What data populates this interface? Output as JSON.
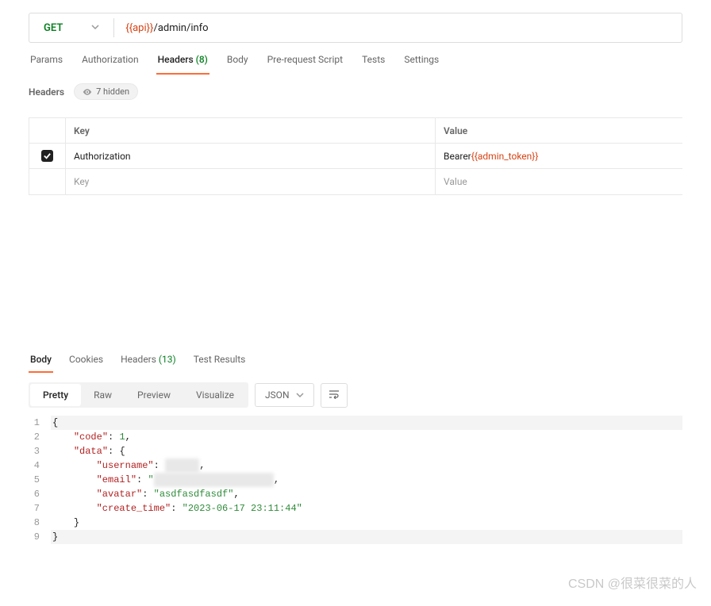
{
  "request": {
    "method": "GET",
    "urlPrefixVar": "{{api}}",
    "urlPath": "/admin/info"
  },
  "tabs": {
    "params": "Params",
    "authorization": "Authorization",
    "headers": "Headers",
    "headersCount": "(8)",
    "body": "Body",
    "preRequest": "Pre-request Script",
    "tests": "Tests",
    "settings": "Settings"
  },
  "headersSection": {
    "title": "Headers",
    "hiddenLabel": "7 hidden",
    "columns": {
      "key": "Key",
      "value": "Value"
    },
    "rows": [
      {
        "checked": true,
        "key": "Authorization",
        "valuePrefix": "Bearer ",
        "valueVar": "{{admin_token}}"
      }
    ],
    "placeholders": {
      "key": "Key",
      "value": "Value"
    }
  },
  "response": {
    "tabs": {
      "body": "Body",
      "cookies": "Cookies",
      "headers": "Headers",
      "headersCount": "(13)",
      "testResults": "Test Results"
    },
    "viewModes": {
      "pretty": "Pretty",
      "raw": "Raw",
      "preview": "Preview",
      "visualize": "Visualize"
    },
    "format": "JSON",
    "json": {
      "lines": [
        {
          "n": "1",
          "indent": 0,
          "open": "{"
        },
        {
          "n": "2",
          "indent": 1,
          "key": "\"code\"",
          "sep": ": ",
          "num": "1",
          "trail": ","
        },
        {
          "n": "3",
          "indent": 1,
          "key": "\"data\"",
          "sep": ": ",
          "open": "{"
        },
        {
          "n": "4",
          "indent": 2,
          "key": "\"username\"",
          "sep": ": ",
          "redact": "xxxxxx",
          "trail": ","
        },
        {
          "n": "5",
          "indent": 2,
          "key": "\"email\"",
          "sep": ": ",
          "strOpen": "\"",
          "redact": "xxxxxxxxxxxxxxxxxxxxx",
          "trail": ","
        },
        {
          "n": "6",
          "indent": 2,
          "key": "\"avatar\"",
          "sep": ": ",
          "str": "\"asdfasdfasdf\"",
          "trail": ","
        },
        {
          "n": "7",
          "indent": 2,
          "key": "\"create_time\"",
          "sep": ": ",
          "str": "\"2023-06-17 23:11:44\""
        },
        {
          "n": "8",
          "indent": 1,
          "close": "}"
        },
        {
          "n": "9",
          "indent": 0,
          "close": "}"
        }
      ]
    }
  },
  "watermark": "CSDN @很菜很菜的人"
}
